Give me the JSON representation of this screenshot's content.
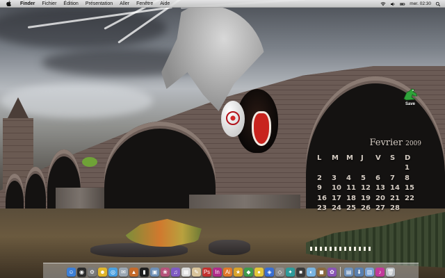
{
  "menubar": {
    "apple_icon": "apple-icon",
    "app_name": "Finder",
    "items": [
      "Fichier",
      "Édition",
      "Présentation",
      "Aller",
      "Fenêtre",
      "Aide"
    ],
    "status_icons": [
      "wifi-icon",
      "volume-icon",
      "battery-icon"
    ],
    "clock": "mer. 02:30"
  },
  "desktop": {
    "icons": [
      {
        "label": "Save",
        "icon": "save-drive-icon"
      }
    ]
  },
  "calendar_widget": {
    "month": "Fevrier",
    "year": "2009",
    "day_headers": [
      "L",
      "M",
      "M",
      "J",
      "V",
      "S",
      "D"
    ],
    "weeks": [
      [
        "",
        "",
        "",
        "",
        "",
        "",
        "1"
      ],
      [
        "2",
        "3",
        "4",
        "5",
        "6",
        "7",
        "8"
      ],
      [
        "9",
        "10",
        "11",
        "12",
        "13",
        "14",
        "15"
      ],
      [
        "16",
        "17",
        "18",
        "19",
        "20",
        "21",
        "22"
      ],
      [
        "23",
        "24",
        "25",
        "26",
        "27",
        "28",
        ""
      ]
    ],
    "text_color": "#e6dcd2"
  },
  "dock": {
    "items": [
      {
        "name": "finder-dock-icon",
        "glyph": "☺",
        "color": "#3d7fd6"
      },
      {
        "name": "dashboard-dock-icon",
        "glyph": "◉",
        "color": "#2b2b2b"
      },
      {
        "name": "system-preferences-dock-icon",
        "glyph": "⚙",
        "color": "#7a7a7a"
      },
      {
        "name": "ichat-dock-icon",
        "glyph": "☻",
        "color": "#e0b52a"
      },
      {
        "name": "safari-dock-icon",
        "glyph": "◎",
        "color": "#4aa0e0"
      },
      {
        "name": "mail-dock-icon",
        "glyph": "✉",
        "color": "#9aa6b2"
      },
      {
        "name": "rocket-dock-icon",
        "glyph": "▲",
        "color": "#c46a2a"
      },
      {
        "name": "terminal-dock-icon",
        "glyph": "▮",
        "color": "#1e1e1e"
      },
      {
        "name": "preview-dock-icon",
        "glyph": "▣",
        "color": "#6e8fb5"
      },
      {
        "name": "photo-dock-icon",
        "glyph": "❀",
        "color": "#b5527a"
      },
      {
        "name": "itunes-dock-icon",
        "glyph": "♫",
        "color": "#7e5bc2"
      },
      {
        "name": "calendar-dock-icon",
        "glyph": "▦",
        "color": "#d9d9d9"
      },
      {
        "name": "text-editor-dock-icon",
        "glyph": "✎",
        "color": "#d8c39a"
      },
      {
        "name": "app-red-dock-icon",
        "glyph": "Ps",
        "color": "#c2312f"
      },
      {
        "name": "app-magenta-dock-icon",
        "glyph": "In",
        "color": "#b02c8a"
      },
      {
        "name": "app-orange-dock-icon",
        "glyph": "Ai",
        "color": "#e0782a"
      },
      {
        "name": "app-gold-dock-icon",
        "glyph": "★",
        "color": "#d8a32a"
      },
      {
        "name": "app-green-dock-icon",
        "glyph": "◆",
        "color": "#3f9a4c"
      },
      {
        "name": "app-yellow-dock-icon",
        "glyph": "●",
        "color": "#e3c63a"
      },
      {
        "name": "app-blue-dock-icon",
        "glyph": "◈",
        "color": "#3a6fd1"
      },
      {
        "name": "app-grey-dock-icon",
        "glyph": "◇",
        "color": "#8d8d8d"
      },
      {
        "name": "app-teal-dock-icon",
        "glyph": "✦",
        "color": "#2f9a9a"
      },
      {
        "name": "app-dark-dock-icon",
        "glyph": "■",
        "color": "#3b3b3b"
      },
      {
        "name": "app-lightblue-dock-icon",
        "glyph": "◐",
        "color": "#79b4e0"
      },
      {
        "name": "app-wood-dock-icon",
        "glyph": "◼",
        "color": "#8a6a40"
      },
      {
        "name": "app-purple-dock-icon",
        "glyph": "✿",
        "color": "#8a54b5"
      }
    ],
    "right_items": [
      {
        "name": "documents-stack-dock-icon",
        "glyph": "▤",
        "color": "#6d8fb8"
      },
      {
        "name": "downloads-stack-dock-icon",
        "glyph": "⬇",
        "color": "#5a7fae"
      },
      {
        "name": "folder-dock-icon",
        "glyph": "▥",
        "color": "#7aa2d4"
      },
      {
        "name": "itunes-mini-dock-icon",
        "glyph": "♪",
        "color": "#c23a9a"
      },
      {
        "name": "trash-dock-icon",
        "glyph": "🗑",
        "color": "#b9bec4"
      }
    ]
  }
}
